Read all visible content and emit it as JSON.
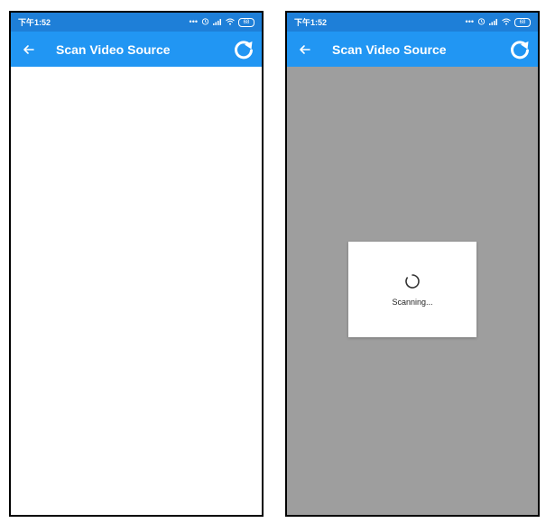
{
  "screens": [
    {
      "status_bar": {
        "time": "下午1:52",
        "icons": [
          "more-dots-icon",
          "alarm-icon",
          "signal-icon",
          "wifi-icon",
          "battery-icon"
        ],
        "battery": "68"
      },
      "app_bar": {
        "title": "Scan Video Source",
        "back_icon": "arrow-back-icon",
        "refresh_icon": "refresh-icon"
      }
    },
    {
      "status_bar": {
        "time": "下午1:52",
        "icons": [
          "more-dots-icon",
          "alarm-icon",
          "signal-icon",
          "wifi-icon",
          "battery-icon"
        ],
        "battery": "68"
      },
      "app_bar": {
        "title": "Scan Video Source",
        "back_icon": "arrow-back-icon",
        "refresh_icon": "refresh-icon"
      },
      "dialog": {
        "message": "Scanning..."
      }
    }
  ],
  "colors": {
    "app_bar": "#2196f3",
    "status_bar": "#1e7fd8",
    "scrim": "#9e9e9e",
    "dialog": "#ffffff"
  }
}
